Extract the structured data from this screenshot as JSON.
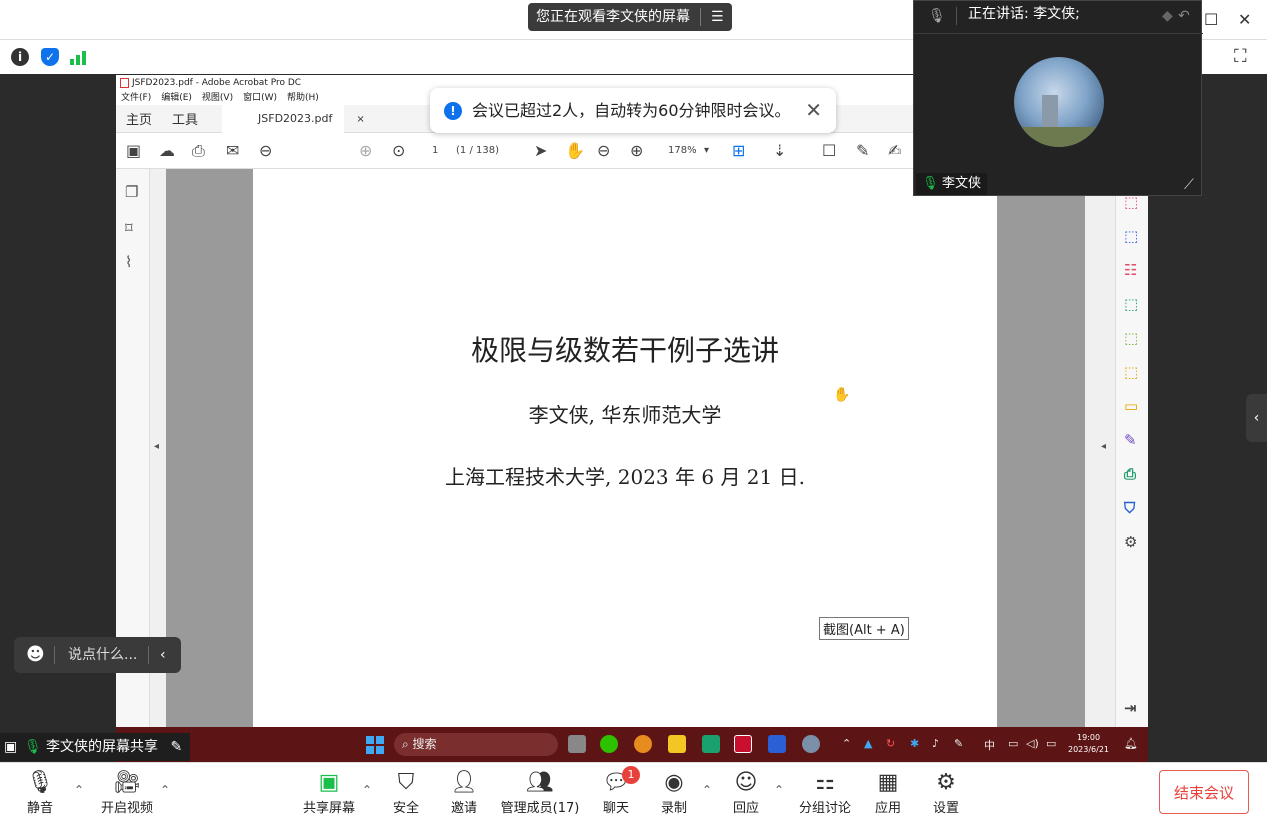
{
  "top": {
    "viewing_banner": "您正在观看李文侠的屏幕",
    "menu_glyph": "☰",
    "restore": "☐",
    "close": "✕",
    "fullscreen": "⛶"
  },
  "acrobat": {
    "window_title": "JSFD2023.pdf - Adobe Acrobat Pro DC",
    "menu": [
      "文件(F)",
      "编辑(E)",
      "视图(V)",
      "窗口(W)",
      "帮助(H)"
    ],
    "tabs": {
      "home": "主页",
      "tools": "工具",
      "doc": "JSFD2023.pdf",
      "doc_close": "×"
    },
    "page_number": "1",
    "page_count": "(1 / 138)",
    "zoom": "178%",
    "document": {
      "title": "极限与级数若干例子选讲",
      "author": "李文侠, 华东师范大学",
      "venue": "上海工程技术大学, 2023 年 6 月 21 日."
    },
    "tooltip": "截图(Alt + A)"
  },
  "taskbar": {
    "search": "搜索",
    "ime": "中",
    "time": "19:00",
    "date": "2023/6/21"
  },
  "toast": {
    "message": "会议已超过2人，自动转为60分钟限时会议。",
    "close": "✕"
  },
  "video": {
    "speaking": "正在讲话:  李文侠;",
    "name": "李文侠"
  },
  "chat_bubble": {
    "placeholder": "说点什么..."
  },
  "share_label": "李文侠的屏幕共享",
  "bottom": {
    "mute": "静音",
    "video": "开启视频",
    "share": "共享屏幕",
    "security": "安全",
    "invite": "邀请",
    "participants": "管理成员(17)",
    "chat": "聊天",
    "chat_badge": "1",
    "record": "录制",
    "reactions": "回应",
    "breakout": "分组讨论",
    "apps": "应用",
    "settings": "设置",
    "end": "结束会议"
  },
  "colors": {
    "accent": "#0e72ed",
    "end": "#e8413b",
    "taskbar": "#5c1414"
  }
}
